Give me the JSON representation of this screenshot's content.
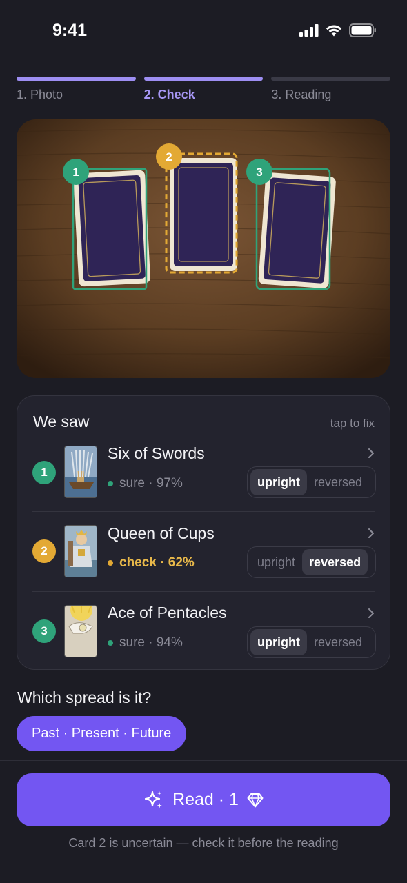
{
  "status_bar": {
    "time": "9:41"
  },
  "steps": [
    {
      "label": "1. Photo",
      "state": "done"
    },
    {
      "label": "2. Check",
      "state": "active"
    },
    {
      "label": "3. Reading",
      "state": "pending"
    }
  ],
  "photo": {
    "markers": [
      {
        "number": "1",
        "status": "sure"
      },
      {
        "number": "2",
        "status": "check"
      },
      {
        "number": "3",
        "status": "sure"
      }
    ]
  },
  "panel": {
    "title": "We saw",
    "hint": "tap to fix",
    "cards": [
      {
        "number": "1",
        "name": "Six of Swords",
        "confidence": "sure · 97%",
        "status": "sure",
        "orientation": "upright",
        "options": [
          "upright",
          "reversed"
        ]
      },
      {
        "number": "2",
        "name": "Queen of Cups",
        "confidence": "check · 62%",
        "status": "check",
        "orientation": "reversed",
        "options": [
          "upright",
          "reversed"
        ]
      },
      {
        "number": "3",
        "name": "Ace of Pentacles",
        "confidence": "sure · 94%",
        "status": "sure",
        "orientation": "upright",
        "options": [
          "upright",
          "reversed"
        ]
      }
    ]
  },
  "spread": {
    "question": "Which spread is it?",
    "selected": "Past · Present · Future"
  },
  "read_button": {
    "label": "Read · 1",
    "icons": [
      "sparkle-icon",
      "gem-icon"
    ]
  },
  "footnote": "Card 2 is uncertain — check it before the reading",
  "colors": {
    "accent": "#7356f2",
    "step_active": "#9d8ef2",
    "sure": "#2fa37a",
    "check": "#e3a934",
    "background": "#1c1c24"
  }
}
